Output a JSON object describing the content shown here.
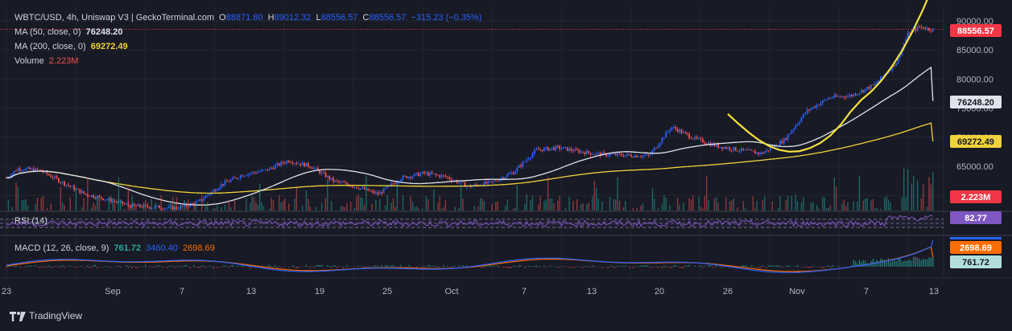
{
  "header": {
    "title": "WBTC/USD, 4h, Uniswap V3 | GeckoTerminal.com",
    "open_label": "O",
    "open": "88871.80",
    "high_label": "H",
    "high": "89012.32",
    "low_label": "L",
    "low": "88556.57",
    "close_label": "C",
    "close": "88556.57",
    "change": "−315.23 (−0.35%)"
  },
  "legend": {
    "ma50_label": "MA (50, close, 0)",
    "ma50_value": "76248.20",
    "ma200_label": "MA (200, close, 0)",
    "ma200_value": "69272.49",
    "volume_label": "Volume",
    "volume_value": "2.223M",
    "rsi_label": "RSI (14)",
    "macd_label": "MACD (12, 26, close, 9)",
    "macd_value": "761.72",
    "macd_signal": "3460.40",
    "macd_line": "2698.69"
  },
  "brand": {
    "label": "TradingView",
    "icon": "tradingview-logo-icon"
  },
  "colors": {
    "background": "#181a25",
    "up": "#2962ff",
    "down": "#ef5350",
    "ma50": "#e0e3eb",
    "ma200": "#f0d23c",
    "curve": "#f5e13c",
    "rsi": "#7e57c2",
    "macd_blue": "#2962ff",
    "macd_orange": "#ff6d00",
    "hist": "#26a69a",
    "price_badge": "#f23645",
    "grid": "#232632"
  },
  "badges": {
    "price": "88556.57",
    "ma50": "76248.20",
    "ma200": "69272.49",
    "volume": "2.223M",
    "rsi": "82.77",
    "macd_signal": "3460.40",
    "macd_line": "2698.69",
    "macd_hist": "761.72"
  },
  "chart_data": {
    "type": "candlestick",
    "title": "WBTC/USD, 4h, Uniswap V3 | GeckoTerminal.com",
    "x_ticks": [
      "23",
      "Sep",
      "7",
      "13",
      "19",
      "25",
      "Oct",
      "7",
      "13",
      "20",
      "26",
      "Nov",
      "7",
      "13"
    ],
    "y_ticks": [
      "90000.00",
      "85000.00",
      "80000.00",
      "75000.00",
      "70000.00",
      "65000.00"
    ],
    "y_range": [
      60000,
      90000
    ],
    "price_path": {
      "x_days": [
        0,
        1,
        3,
        5,
        7,
        9,
        11,
        13,
        15,
        17,
        19,
        21,
        23,
        25,
        27,
        29,
        31,
        33,
        35,
        37,
        39,
        41,
        43,
        45,
        47,
        49,
        51,
        53,
        55,
        57,
        59,
        61,
        63,
        65,
        67,
        69,
        71,
        73,
        75,
        77,
        79,
        80,
        81,
        82
      ],
      "close": [
        63000,
        64600,
        64300,
        62200,
        60200,
        59300,
        58200,
        58000,
        57800,
        58800,
        61800,
        63600,
        64300,
        66000,
        65000,
        62500,
        61500,
        60200,
        63000,
        63800,
        63200,
        61500,
        62200,
        64000,
        67800,
        68200,
        67500,
        67000,
        66900,
        66800,
        71800,
        69800,
        68500,
        67800,
        67200,
        69500,
        74500,
        76800,
        77200,
        79000,
        83000,
        87800,
        89000,
        88556.57
      ]
    },
    "ma50_last": 76248.2,
    "ma200_last": 69272.49,
    "volume_last": "2.223M",
    "rsi_last": 82.77,
    "macd": {
      "macd": 3460.4,
      "signal": 2698.69,
      "histogram": 761.72
    }
  }
}
